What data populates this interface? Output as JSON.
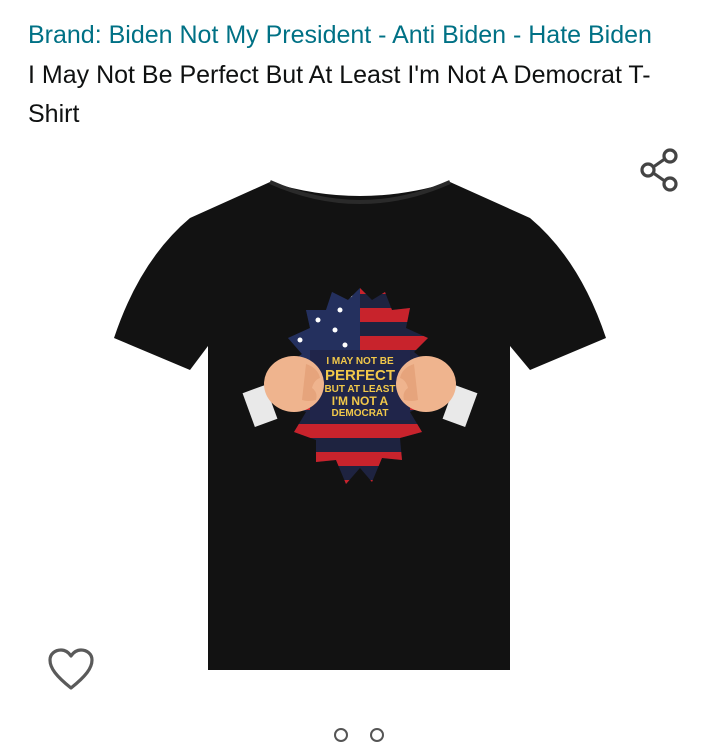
{
  "product": {
    "brand_link": "Brand: Biden Not My President - Anti Biden - Hate Biden",
    "title": "I May Not Be Perfect But At Least I'm Not A Democrat T-Shirt"
  },
  "image": {
    "shirt_print_lines": [
      "I MAY NOT BE",
      "PERFECT",
      "BUT AT LEAST",
      "I'M NOT A",
      "DEMOCRAT"
    ]
  },
  "icons": {
    "share": "share-icon",
    "wishlist": "heart-outline-icon"
  },
  "carousel": {
    "dot_count": 2,
    "active_index": 0
  },
  "colors": {
    "brand_link": "#007185",
    "text": "#0f1111",
    "shirt": "#111111"
  }
}
